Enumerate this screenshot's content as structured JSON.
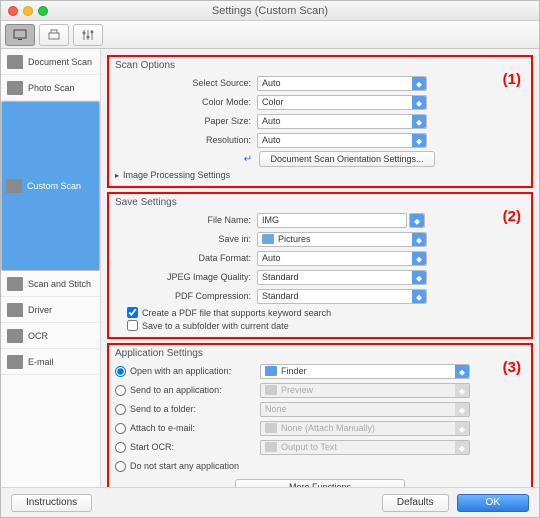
{
  "window_title": "Settings (Custom Scan)",
  "sidebar": {
    "items": [
      {
        "label": "Document Scan"
      },
      {
        "label": "Photo Scan"
      },
      {
        "label": "Custom Scan"
      },
      {
        "label": "Scan and Stitch"
      },
      {
        "label": "Driver"
      },
      {
        "label": "OCR"
      },
      {
        "label": "E-mail"
      }
    ]
  },
  "scan_options": {
    "title": "Scan Options",
    "num": "(1)",
    "select_source_label": "Select Source:",
    "select_source": "Auto",
    "color_mode_label": "Color Mode:",
    "color_mode": "Color",
    "paper_size_label": "Paper Size:",
    "paper_size": "Auto",
    "resolution_label": "Resolution:",
    "resolution": "Auto",
    "orientation_btn": "Document Scan Orientation Settings...",
    "img_proc": "Image Processing Settings"
  },
  "save_settings": {
    "title": "Save Settings",
    "num": "(2)",
    "file_name_label": "File Name:",
    "file_name": "IMG",
    "save_in_label": "Save in:",
    "save_in": "Pictures",
    "data_format_label": "Data Format:",
    "data_format": "Auto",
    "jpeg_label": "JPEG Image Quality:",
    "jpeg": "Standard",
    "pdf_label": "PDF Compression:",
    "pdf": "Standard",
    "ck1": "Create a PDF file that supports keyword search",
    "ck2": "Save to a subfolder with current date"
  },
  "app_settings": {
    "title": "Application Settings",
    "num": "(3)",
    "open_with": "Open with an application:",
    "open_with_val": "Finder",
    "send_app": "Send to an application:",
    "send_app_val": "Preview",
    "send_folder": "Send to a folder:",
    "send_folder_val": "None",
    "attach": "Attach to e-mail:",
    "attach_val": "None (Attach Manually)",
    "start_ocr": "Start OCR:",
    "start_ocr_val": "Output to Text",
    "do_not_start": "Do not start any application",
    "more_functions": "More Functions"
  },
  "footer": {
    "instructions": "Instructions",
    "defaults": "Defaults",
    "ok": "OK"
  }
}
